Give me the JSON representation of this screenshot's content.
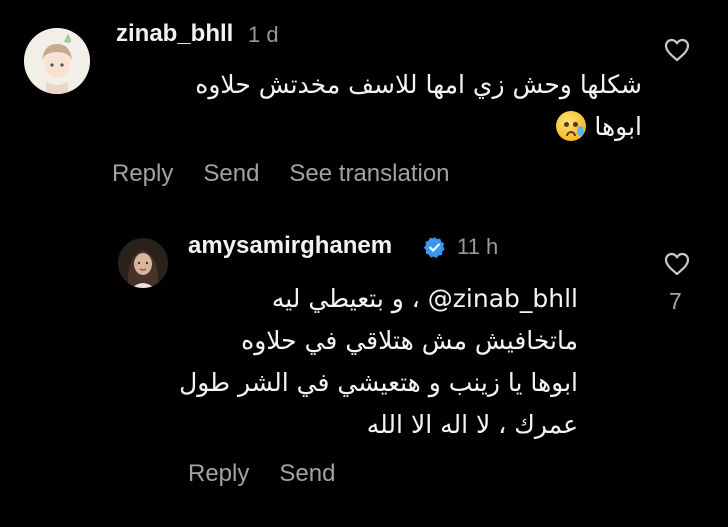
{
  "comment": {
    "username": "zinab_bhll",
    "time": "1 d",
    "text_line1": "شكلها وحش زي امها للاسف مخدتش حلاوه",
    "text_line2": "ابوها",
    "emoji": "crying-face",
    "actions": {
      "reply": "Reply",
      "send": "Send",
      "translate": "See translation"
    }
  },
  "reply": {
    "username": "amysamirghanem",
    "verified": true,
    "time": "11 h",
    "mention": "@zinab_bhll",
    "line1_tail": " ، و بتعيطي ليه",
    "line2": "ماتخافيش مش هتلاقي في حلاوه",
    "line3": "ابوها يا زينب و هتعيشي في الشر طول",
    "line4": "عمرك ، لا اله الا الله",
    "like_count": "7",
    "actions": {
      "reply": "Reply",
      "send": "Send"
    }
  },
  "colors": {
    "background": "#000000",
    "text": "#f4f4f4",
    "muted": "#a2a2a2",
    "verified_badge": "#3897f0"
  }
}
